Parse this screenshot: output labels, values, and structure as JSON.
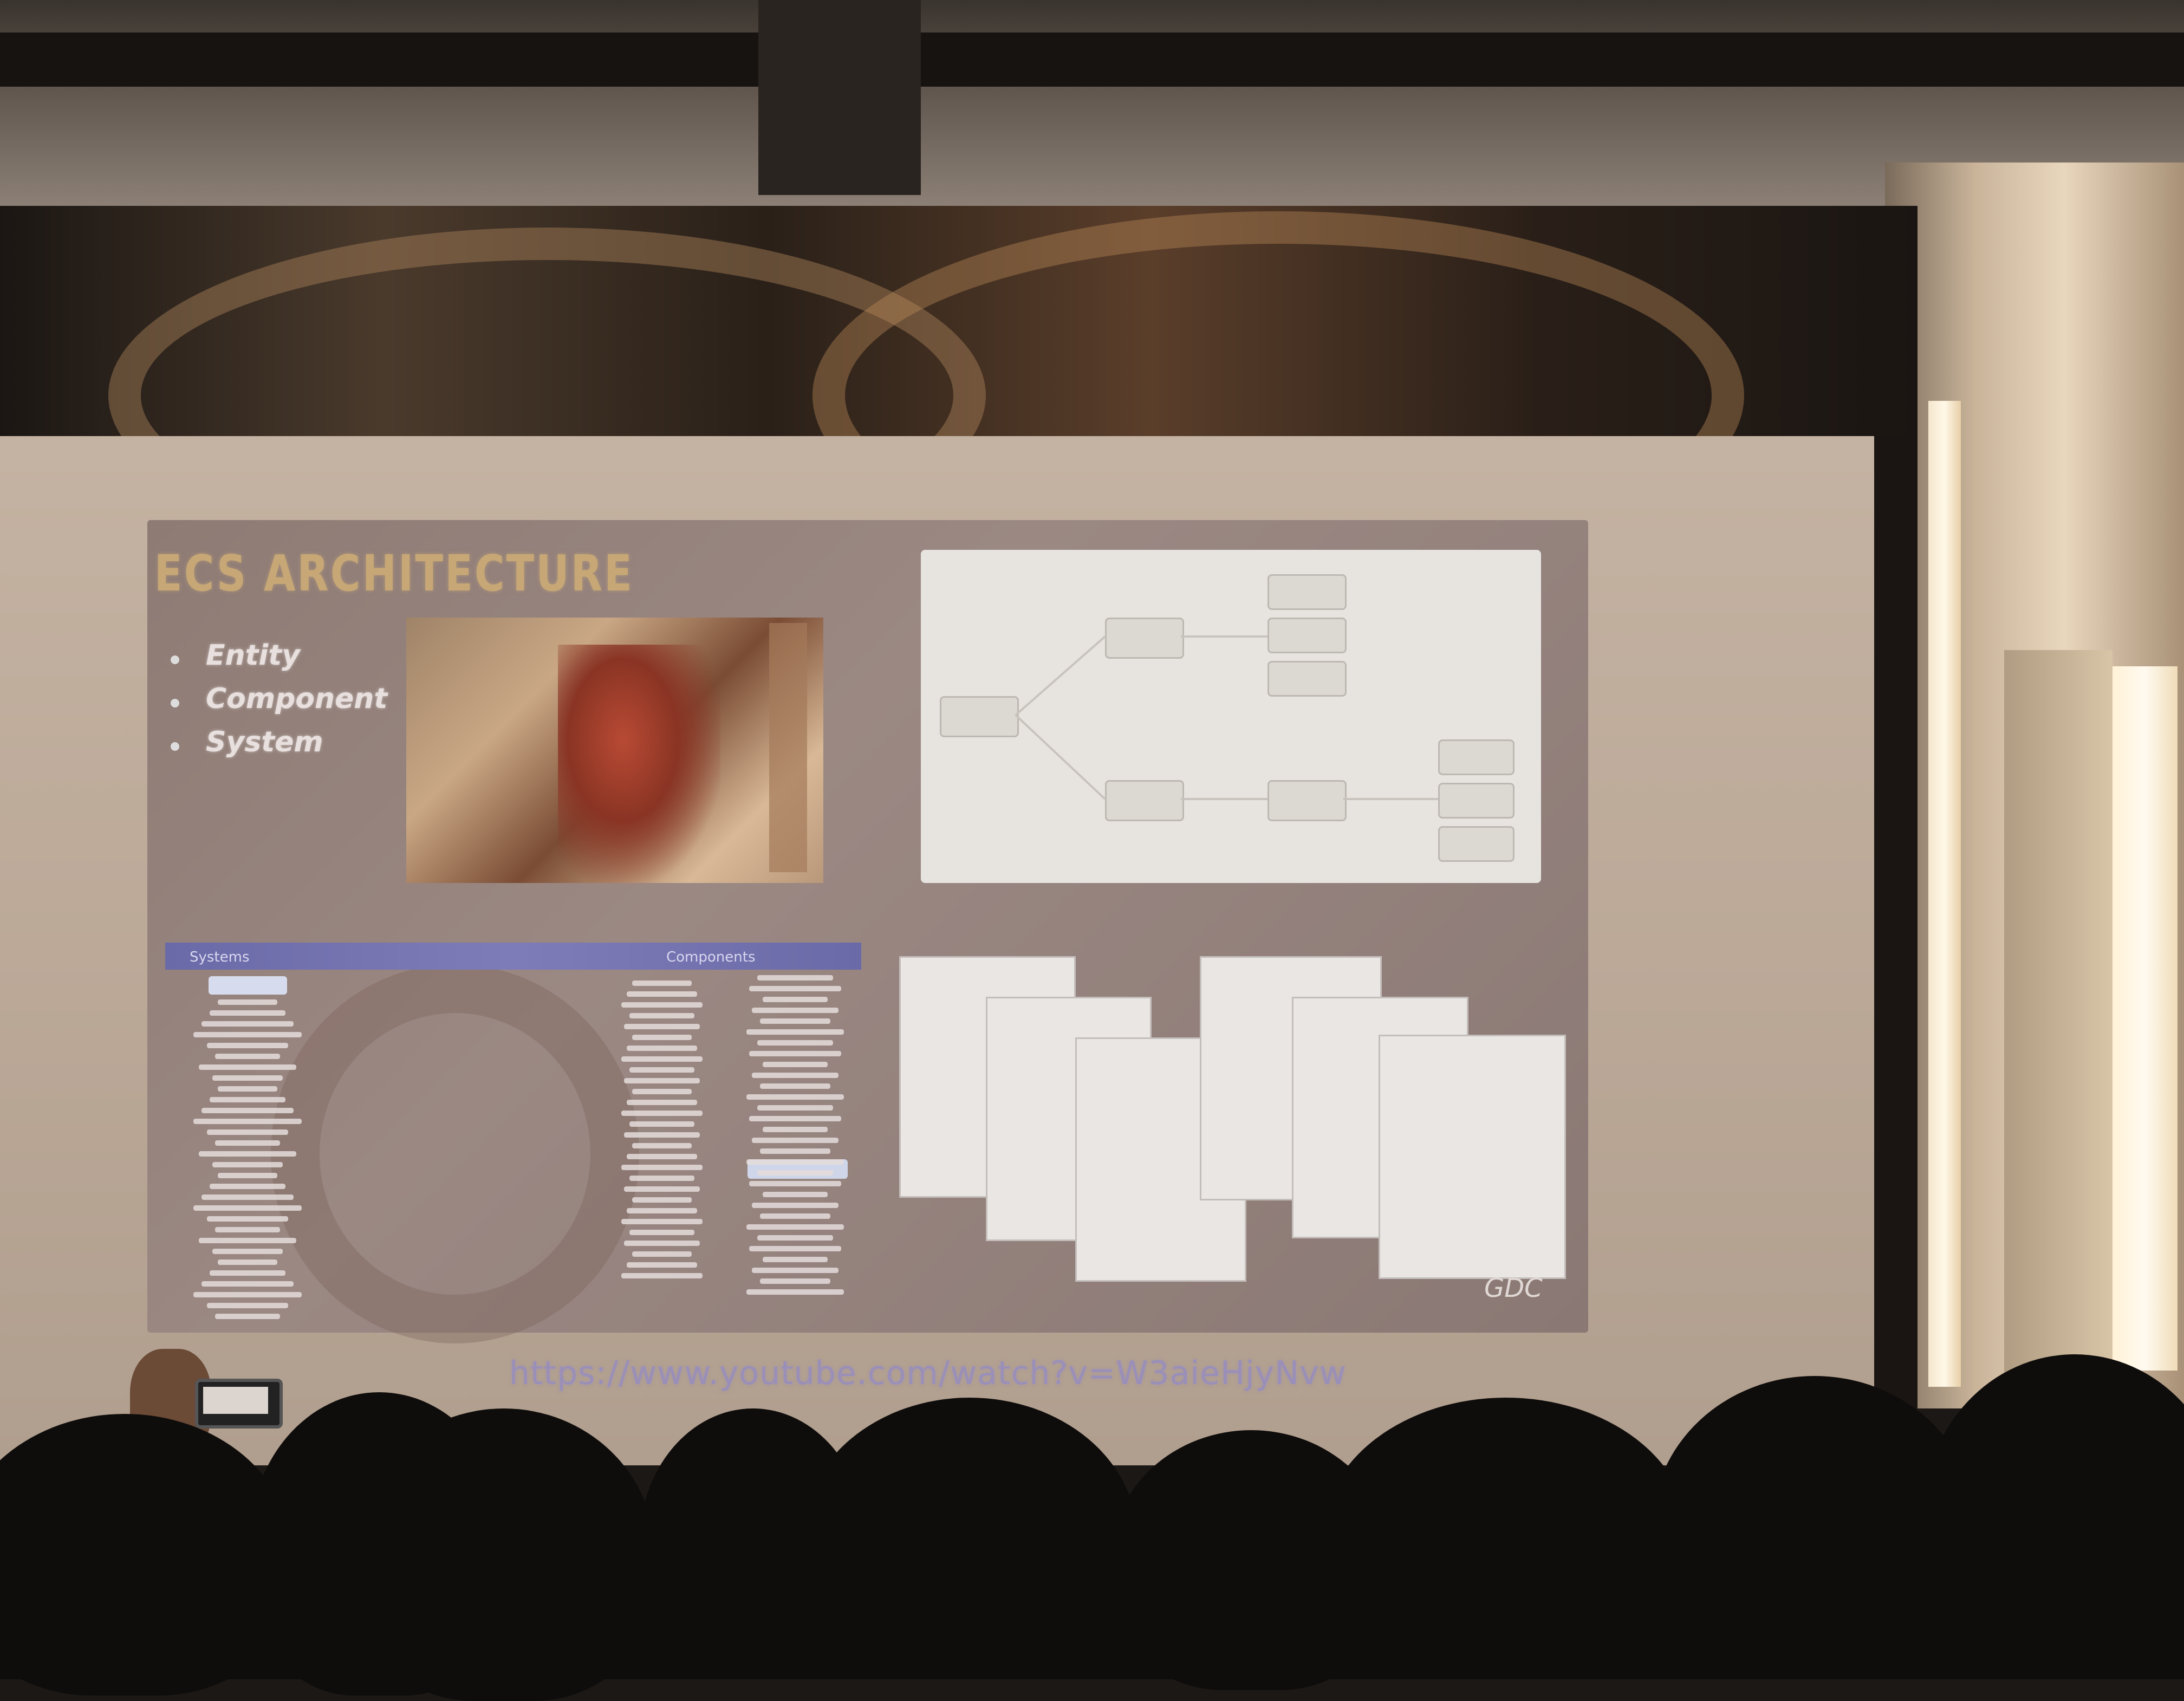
{
  "slide": {
    "title": "ECS ARCHITECTURE",
    "bullets": [
      "Entity",
      "Component",
      "System"
    ],
    "table_headers": [
      "Systems",
      "Components"
    ],
    "logo": "GDC"
  },
  "caption_url": "https://www.youtube.com/watch?v=W3aieHjyNvw"
}
